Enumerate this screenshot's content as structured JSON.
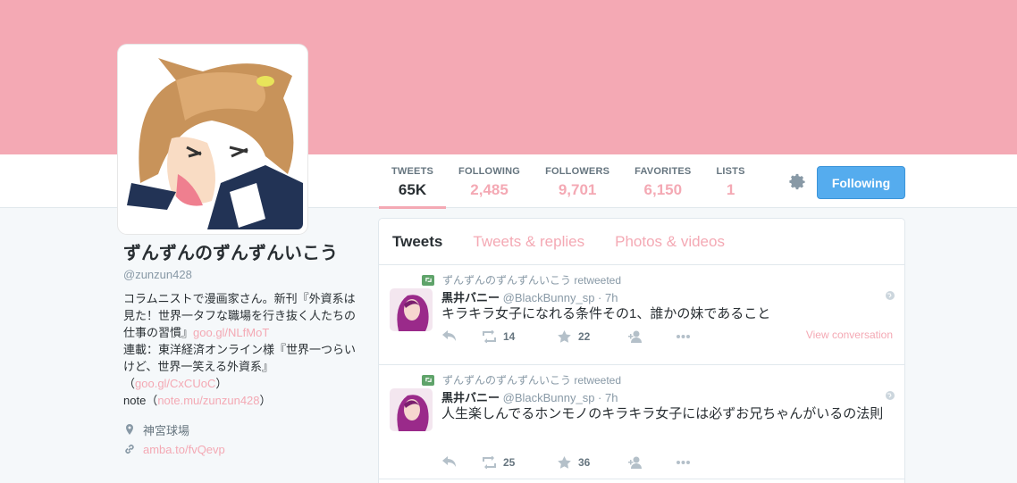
{
  "profile": {
    "name": "ずんずんのずんずんいこう",
    "handle": "@zunzun428",
    "bio_lines": [
      {
        "text": "コラムニストで漫画家さん。新刊『外資系は見た！世界一タフな職場を行き抜く人たちの仕事の習慣』",
        "link": "goo.gl/NLfMoT"
      },
      {
        "text": "連載：東洋経済オンライン様『世界一つらいけど、世界一笑える外資系』（",
        "link": "goo.gl/CxCUoC",
        "tail": "）"
      },
      {
        "text": "note（",
        "link": "note.mu/zunzun428",
        "tail": "）"
      }
    ],
    "location": "神宮球場",
    "url": "amba.to/fvQevp"
  },
  "stats": [
    {
      "label": "TWEETS",
      "value": "65K"
    },
    {
      "label": "FOLLOWING",
      "value": "2,485"
    },
    {
      "label": "FOLLOWERS",
      "value": "9,701"
    },
    {
      "label": "FAVORITES",
      "value": "6,150"
    },
    {
      "label": "LISTS",
      "value": "1"
    }
  ],
  "follow_button": "Following",
  "tabs": [
    "Tweets",
    "Tweets & replies",
    "Photos & videos"
  ],
  "tweets": [
    {
      "retweeted_by": "ずんずんのずんずんいこう retweeted",
      "name": "黒井バニー",
      "handle_time": "@BlackBunny_sp · 7h",
      "text": "キラキラ女子になれる条件その1、誰かの妹であること",
      "retweets": "14",
      "favorites": "22",
      "view_conversation": "View conversation"
    },
    {
      "retweeted_by": "ずんずんのずんずんいこう retweeted",
      "name": "黒井バニー",
      "handle_time": "@BlackBunny_sp · 7h",
      "text": "人生楽しんでるホンモノのキラキラ女子には必ずお兄ちゃんがいるの法則",
      "retweets": "25",
      "favorites": "36"
    }
  ],
  "colors": {
    "banner": "#f4a9b4",
    "accent": "#f4a9b4",
    "follow": "#55acee"
  },
  "icons": [
    "settings-gear-icon",
    "location-pin-icon",
    "link-icon",
    "retweet-icon",
    "reply-icon",
    "favorite-star-icon",
    "follow-icon",
    "more-icon",
    "globe-icon"
  ]
}
